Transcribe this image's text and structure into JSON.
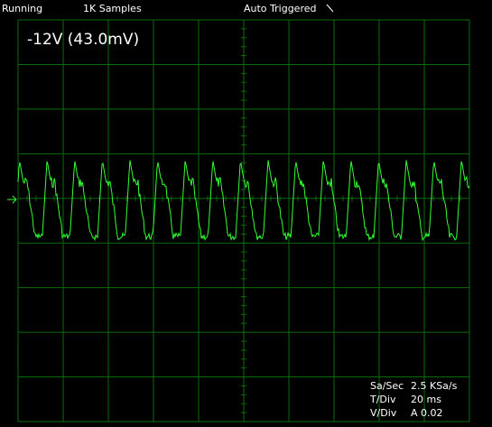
{
  "status_bar": {
    "run_state": "Running",
    "samples": "1K Samples",
    "trigger_mode": "Auto Triggered",
    "trigger_slope_icon": "falling-edge-icon"
  },
  "channel_label": "-12V (43.0mV)",
  "colors": {
    "background": "#000000",
    "grid": "#0a6b0a",
    "trace": "#33ff33",
    "text": "#ffffff"
  },
  "readouts": {
    "sample_rate_label": "Sa/Sec",
    "sample_rate_value": "2.5 KSa/s",
    "time_div_label": "T/Div",
    "time_div_value": "20 ms",
    "volt_div_label": "V/Div",
    "volt_div_value": "A 0.02"
  },
  "ground_marker_icon": "arrow-right-icon",
  "display": {
    "horizontal_divisions": 10,
    "vertical_divisions": 9
  }
}
